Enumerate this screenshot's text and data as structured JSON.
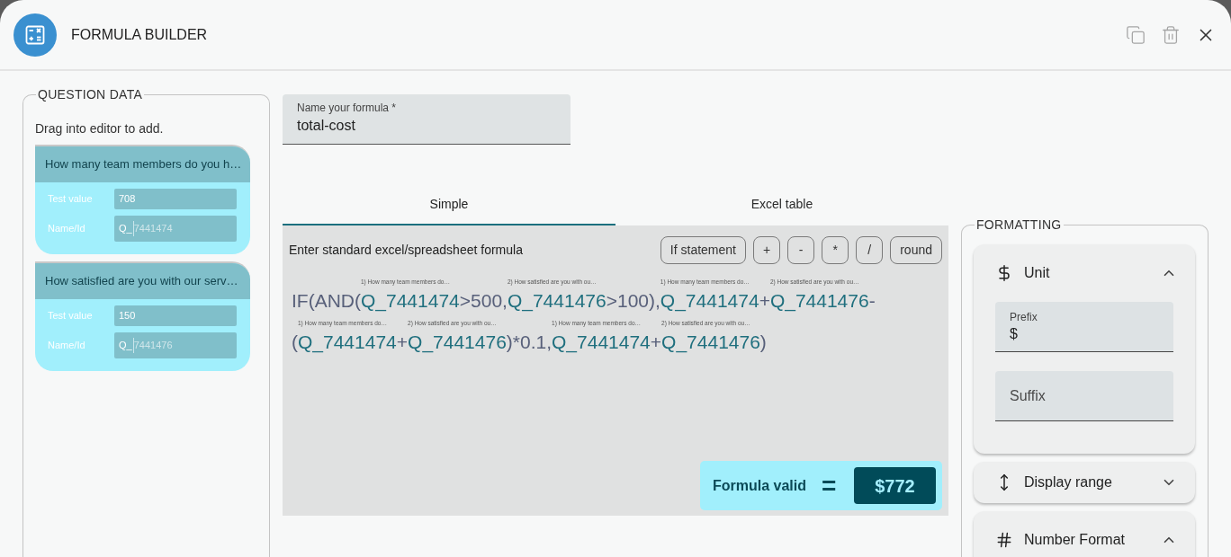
{
  "window": {
    "title": "FORMULA BUILDER",
    "actions": [
      {
        "kind": "copy",
        "disabled": true
      },
      {
        "kind": "delete",
        "disabled": true
      },
      {
        "kind": "close",
        "disabled": false
      }
    ]
  },
  "question_data": {
    "title": "QUESTION DATA",
    "hint": "Drag into editor to add.",
    "questions": [
      {
        "title": "How many team members do you h…",
        "test_label": "Test value",
        "test_value": "708",
        "name_label": "Name/Id",
        "name_prefix": "Q_",
        "name_id": "7441474"
      },
      {
        "title": "How satisfied are you with our serv…",
        "test_label": "Test value",
        "test_value": "150",
        "name_label": "Name/Id",
        "name_prefix": "Q_",
        "name_id": "7441476"
      }
    ]
  },
  "formula_name": {
    "label": "Name your formula *",
    "value": "total-cost"
  },
  "tabs": [
    {
      "label": "Simple",
      "selected": true
    },
    {
      "label": "Excel table",
      "selected": false
    }
  ],
  "editor": {
    "instruction": "Enter standard excel/spreadsheet formula",
    "buttons": [
      "If statement",
      "+",
      "-",
      "*",
      "/",
      "round"
    ],
    "formula_lines": [
      [
        {
          "kind": "operator",
          "text": "IF(AND("
        },
        {
          "kind": "reference",
          "text": "Q_7441474",
          "hint": "1) How many team members do…"
        },
        {
          "kind": "operator",
          "text": ">500,"
        },
        {
          "kind": "reference",
          "text": "Q_7441476",
          "hint": "2) How satisfied are you with ou…"
        },
        {
          "kind": "operator",
          "text": ">100),"
        },
        {
          "kind": "reference",
          "text": "Q_7441474",
          "hint": "1) How many team members do…"
        },
        {
          "kind": "operator",
          "text": "+"
        },
        {
          "kind": "reference",
          "text": "Q_7441476",
          "hint": "2) How satisfied are you with ou…"
        },
        {
          "kind": "operator",
          "text": "-"
        }
      ],
      [
        {
          "kind": "operator",
          "text": "("
        },
        {
          "kind": "reference",
          "text": "Q_7441474",
          "hint": "1) How many team members do…"
        },
        {
          "kind": "operator",
          "text": "+"
        },
        {
          "kind": "reference",
          "text": "Q_7441476",
          "hint": "2) How satisfied are you with ou…"
        },
        {
          "kind": "operator",
          "text": ")*0.1,"
        },
        {
          "kind": "reference",
          "text": "Q_7441474",
          "hint": "1) How many team members do…"
        },
        {
          "kind": "operator",
          "text": "+"
        },
        {
          "kind": "reference",
          "text": "Q_7441476",
          "hint": "2) How satisfied are you with ou…"
        },
        {
          "kind": "operator",
          "text": ")"
        }
      ]
    ],
    "result": {
      "status": "Formula valid",
      "equals": "=",
      "value": "$772"
    }
  },
  "formatting": {
    "title": "FORMATTING",
    "sections": [
      {
        "kind": "unit",
        "label": "Unit",
        "expanded": true,
        "fields": [
          {
            "label": "Prefix",
            "value": "$"
          },
          {
            "placeholder": "Suffix"
          }
        ]
      },
      {
        "kind": "range",
        "label": "Display range",
        "expanded": false
      },
      {
        "kind": "number",
        "label": "Number Format",
        "expanded": true
      }
    ]
  }
}
